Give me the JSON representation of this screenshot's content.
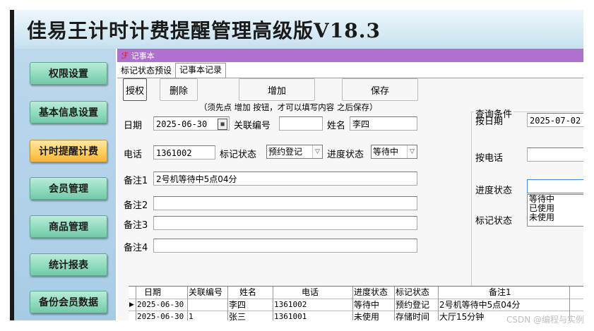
{
  "app_title": "佳易王计时计费提醒管理高级版V18.3",
  "sidebar": {
    "items": [
      {
        "label": "权限设置"
      },
      {
        "label": "基本信息设置"
      },
      {
        "label": "计时提醒计费"
      },
      {
        "label": "会员管理"
      },
      {
        "label": "商品管理"
      },
      {
        "label": "统计报表"
      },
      {
        "label": "备份会员数据"
      }
    ]
  },
  "window": {
    "title": "记事本"
  },
  "tabs": [
    {
      "label": "标记状态预设"
    },
    {
      "label": "记事本记录"
    }
  ],
  "toolbar": {
    "auth": "授权",
    "delete": "删除",
    "add": "增加",
    "save": "保存",
    "hint": "（须先点 增加 按钮，才可以填写内容 之后保存）"
  },
  "form": {
    "date_label": "日期",
    "date_value": "2025-06-30",
    "link_no_label": "关联编号",
    "link_no_value": "",
    "name_label": "姓名",
    "name_value": "李四",
    "phone_label": "电话",
    "phone_value": "1361002",
    "mark_status_label": "标记状态",
    "mark_status_value": "预约登记",
    "progress_label": "进度状态",
    "progress_value": "等待中",
    "note1_label": "备注1",
    "note1_value": "2号机等待中5点04分",
    "note2_label": "备注2",
    "note2_value": "",
    "note3_label": "备注3",
    "note3_value": "",
    "note4_label": "备注4",
    "note4_value": ""
  },
  "query": {
    "title": "查询条件",
    "by_date_label": "按日期",
    "by_date_value": "2025-07-02",
    "by_phone_label": "按电话",
    "by_phone_value": "",
    "progress_label": "进度状态",
    "progress_value": "",
    "progress_options": [
      "等待中",
      "已使用",
      "未使用"
    ],
    "mark_label": "标记状态"
  },
  "table": {
    "columns": [
      "日期",
      "关联编号",
      "姓名",
      "电话",
      "进度状态",
      "标记状态",
      "备注1"
    ],
    "rows": [
      [
        "2025-06-30",
        "",
        "李四",
        "1361002",
        "等待中",
        "预约登记",
        "2号机等待中5点04分"
      ],
      [
        "2025-06-30",
        "1",
        "张三",
        "1361001",
        "未使用",
        "存储时间",
        "大厅15分钟"
      ]
    ],
    "current_marker": "▶"
  },
  "watermark": "CSDN @编程与实例",
  "colors": {
    "window_title": "#b070d0",
    "active_nav": "#ffcf5e",
    "nav_button": "#8fdbbd"
  }
}
